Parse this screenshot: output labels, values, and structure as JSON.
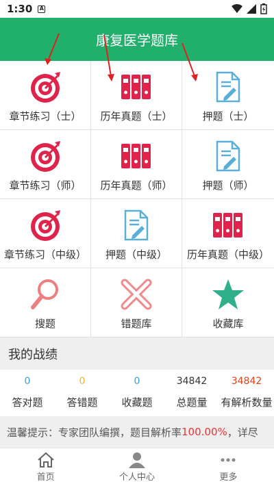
{
  "status": {
    "time": "1:30",
    "notif_letter": "A"
  },
  "header": {
    "title": "康复医学题库"
  },
  "grid": [
    {
      "label": "章节练习（士）",
      "icon": "target-icon"
    },
    {
      "label": "历年真题（士）",
      "icon": "binders-icon"
    },
    {
      "label": "押题（士）",
      "icon": "document-icon"
    },
    {
      "label": "章节练习（师）",
      "icon": "target-icon"
    },
    {
      "label": "历年真题（师）",
      "icon": "binders-icon"
    },
    {
      "label": "押题（师）",
      "icon": "document-icon"
    },
    {
      "label": "章节练习（中级）",
      "icon": "target-icon"
    },
    {
      "label": "押题（中级）",
      "icon": "document-icon"
    },
    {
      "label": "历年真题（中级）",
      "icon": "binders-icon"
    },
    {
      "label": "搜题",
      "icon": "search-icon"
    },
    {
      "label": "错题库",
      "icon": "cross-icon"
    },
    {
      "label": "收藏库",
      "icon": "star-icon"
    }
  ],
  "stats_section": {
    "title": "我的战绩"
  },
  "stats": [
    {
      "value": "0",
      "label": "答对题",
      "color": "#3aa0d8"
    },
    {
      "value": "0",
      "label": "答错题",
      "color": "#f0b63c"
    },
    {
      "value": "0",
      "label": "收藏题",
      "color": "#3aa0d8"
    },
    {
      "value": "34842",
      "label": "总题量",
      "color": "#333333"
    },
    {
      "value": "34842",
      "label": "有解析数量",
      "color": "#e0421e"
    }
  ],
  "tip": {
    "prefix": "温馨提示：专家团队编撰，题目解析率",
    "percent": "100.00%",
    "suffix": "，详尽"
  },
  "tabs": [
    {
      "label": "首页",
      "icon": "home-icon"
    },
    {
      "label": "个人中心",
      "icon": "person-icon"
    },
    {
      "label": "更多",
      "icon": "more-icon"
    }
  ],
  "colors": {
    "header": "#20b06b",
    "icon_red": "#e0234a",
    "icon_blue": "#5aafd9",
    "star": "#2fb08a",
    "cross": "#f28a8a",
    "search": "#ee7f7f",
    "arrow": "#e02020"
  }
}
